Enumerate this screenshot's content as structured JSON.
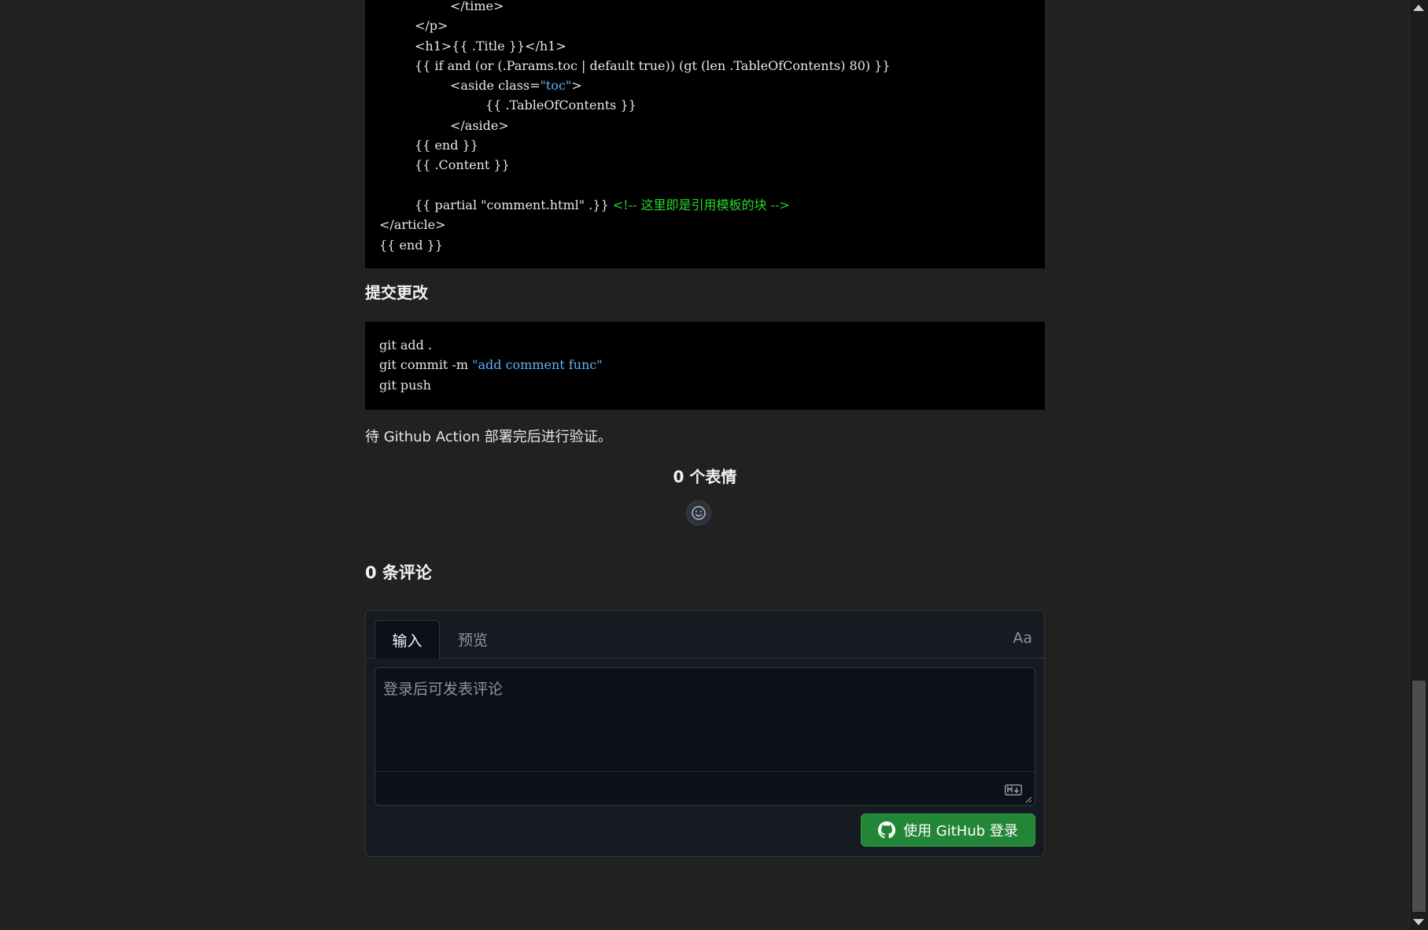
{
  "code_block_1": {
    "lines": [
      {
        "indent": 12,
        "parts": [
          {
            "t": "</time>"
          }
        ]
      },
      {
        "indent": 6,
        "parts": [
          {
            "t": "</p>"
          }
        ]
      },
      {
        "indent": 6,
        "parts": [
          {
            "t": "<h1>{{ .Title }}</h1>"
          }
        ]
      },
      {
        "indent": 6,
        "parts": [
          {
            "t": "{{ if and (or (.Params.toc | default true)) (gt (len .TableOfContents) 80) }}"
          }
        ]
      },
      {
        "indent": 12,
        "parts": [
          {
            "t": "<aside class="
          },
          {
            "t": "\"toc\"",
            "c": "str"
          },
          {
            "t": ">"
          }
        ]
      },
      {
        "indent": 18,
        "parts": [
          {
            "t": "{{ .TableOfContents }}"
          }
        ]
      },
      {
        "indent": 12,
        "parts": [
          {
            "t": "</aside>"
          }
        ]
      },
      {
        "indent": 6,
        "parts": [
          {
            "t": "{{ end }}"
          }
        ]
      },
      {
        "indent": 6,
        "parts": [
          {
            "t": "{{ .Content }}"
          }
        ]
      },
      {
        "indent": 0,
        "parts": [
          {
            "t": ""
          }
        ]
      },
      {
        "indent": 6,
        "parts": [
          {
            "t": "{{ partial \"comment.html\" .}} "
          },
          {
            "t": "<!-- 这里即是引用模板的块 -->",
            "c": "cmt"
          }
        ]
      },
      {
        "indent": 0,
        "parts": [
          {
            "t": "</article>"
          }
        ]
      },
      {
        "indent": 0,
        "parts": [
          {
            "t": "{{ end }}"
          }
        ]
      }
    ]
  },
  "section_heading": "提交更改",
  "code_block_2": {
    "lines": [
      {
        "indent": 0,
        "parts": [
          {
            "t": "git add ."
          }
        ]
      },
      {
        "indent": 0,
        "parts": [
          {
            "t": "git commit -m "
          },
          {
            "t": "\"add comment func\"",
            "c": "str"
          }
        ]
      },
      {
        "indent": 0,
        "parts": [
          {
            "t": "git push"
          }
        ]
      }
    ]
  },
  "paragraph": "待 Github Action 部署完后进行验证。",
  "reactions": {
    "title": "0 个表情",
    "button_icon": "smiley-icon"
  },
  "comments": {
    "title": "0 条评论",
    "tab_write": "输入",
    "tab_preview": "预览",
    "text_size_label": "Aa",
    "placeholder": "登录后可发表评论",
    "markdown_icon": "markdown-icon",
    "login_button": "使用 GitHub 登录",
    "login_icon": "github-icon",
    "button_color": "#238636"
  },
  "colors": {
    "page_bg": "#212121",
    "code_bg": "#000000",
    "string": "#5fb3f6",
    "comment": "#28d62c"
  }
}
